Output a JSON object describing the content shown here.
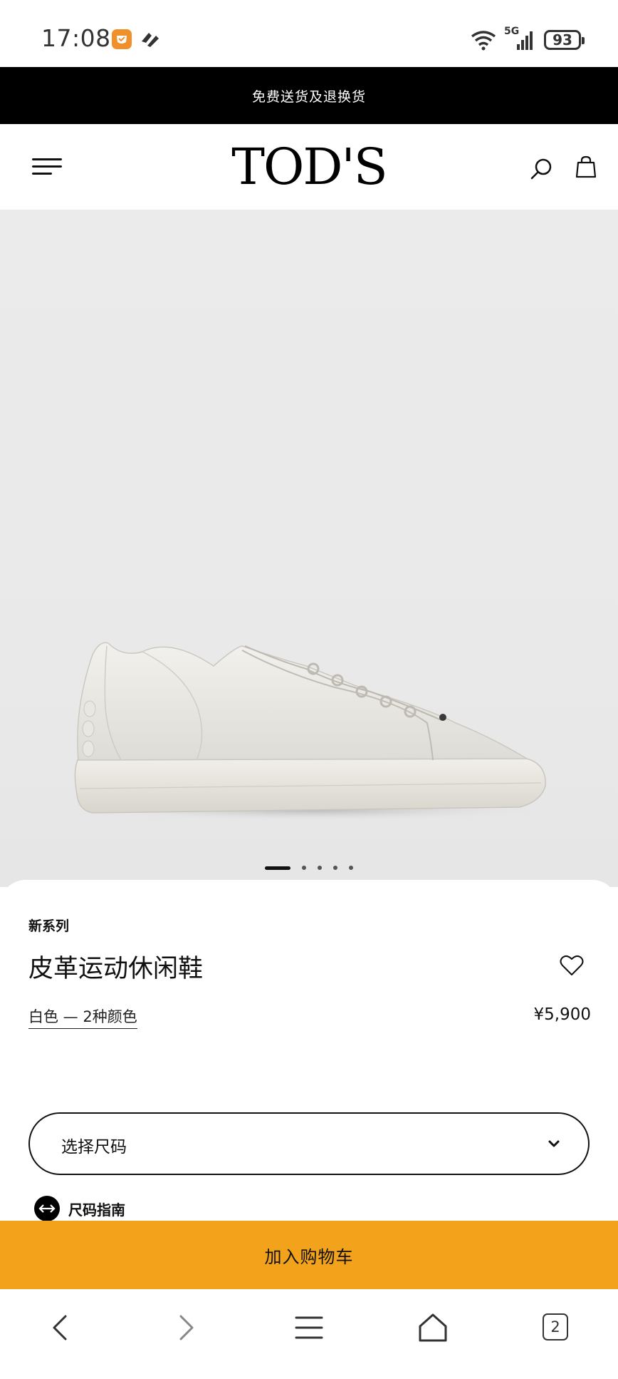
{
  "status_bar": {
    "time": "17:08",
    "network": "5G",
    "battery": "93"
  },
  "promo": {
    "text": "免费送货及退换货"
  },
  "header": {
    "logo": "TOD'S"
  },
  "carousel": {
    "total_slides": 5,
    "active_index": 0
  },
  "product": {
    "collection": "新系列",
    "name": "皮革运动休闲鞋",
    "color_info": "白色 — 2种颜色",
    "price": "¥5,900"
  },
  "size_selector": {
    "label": "选择尺码"
  },
  "size_guide": {
    "label": "尺码指南"
  },
  "cart": {
    "button_label": "加入购物车",
    "accent_color": "#f2a21b"
  },
  "browser": {
    "tab_count": "2"
  }
}
